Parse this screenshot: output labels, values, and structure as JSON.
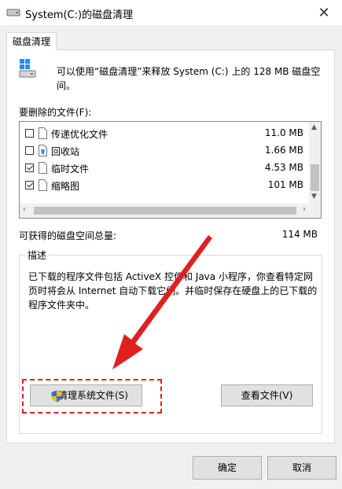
{
  "window": {
    "title": "System(C:)的磁盘清理",
    "close_glyph": "✕"
  },
  "tabs": [
    {
      "label": "磁盘清理"
    }
  ],
  "header": {
    "text": "可以使用“磁盘清理”来释放 System (C:) 上的 128 MB 磁盘空间。"
  },
  "files_label": "要删除的文件(F):",
  "files": [
    {
      "name": "传递优化文件",
      "size": "11.0 MB",
      "checked": false,
      "icon": "file-icon"
    },
    {
      "name": "回收站",
      "size": "1.66 MB",
      "checked": false,
      "icon": "recycle-bin-icon"
    },
    {
      "name": "临时文件",
      "size": "4.53 MB",
      "checked": true,
      "icon": "file-icon"
    },
    {
      "name": "缩略图",
      "size": "101 MB",
      "checked": true,
      "icon": "file-icon"
    }
  ],
  "total": {
    "label": "可获得的磁盘空间总量:",
    "value": "114 MB"
  },
  "description": {
    "legend": "描述",
    "text": "已下载的程序文件包括 ActiveX 控件和 Java 小程序，你查看特定网页时将会从 Internet 自动下载它们。并临时保存在硬盘上的已下载的程序文件夹中。"
  },
  "buttons": {
    "cleanup_system": "清理系统文件(S)",
    "view_files": "查看文件(V)",
    "ok": "确定",
    "cancel": "取消"
  },
  "colors": {
    "annotation": "#e02020",
    "accent": "#0078d7"
  }
}
